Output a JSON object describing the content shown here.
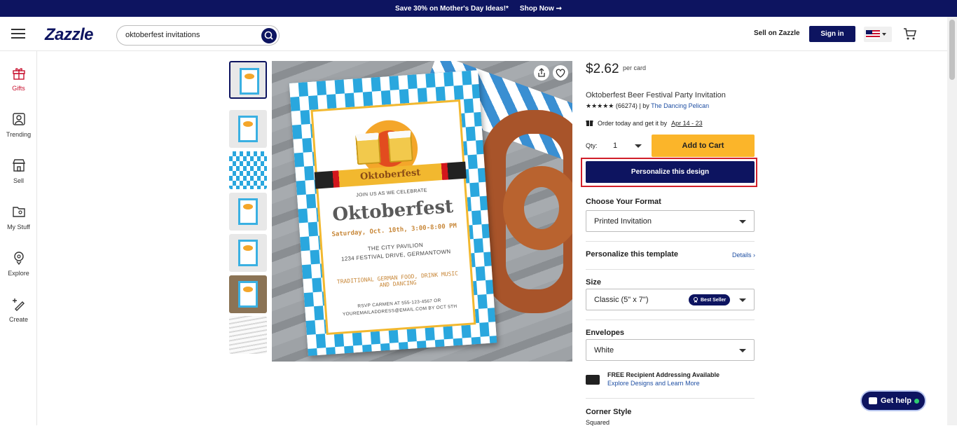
{
  "promo": {
    "text": "Save 30% on Mother's Day Ideas!*",
    "cta": "Shop Now ➞"
  },
  "header": {
    "logo": "Zazzle",
    "search_value": "oktoberfest invitations",
    "sell_label": "Sell on Zazzle",
    "signin_label": "Sign in"
  },
  "rail": {
    "items": [
      {
        "label": "Gifts",
        "icon": "gift-icon"
      },
      {
        "label": "Trending",
        "icon": "trending-icon"
      },
      {
        "label": "Sell",
        "icon": "store-icon"
      },
      {
        "label": "My Stuff",
        "icon": "folder-icon"
      },
      {
        "label": "Explore",
        "icon": "explore-icon"
      },
      {
        "label": "Create",
        "icon": "create-icon"
      }
    ]
  },
  "card": {
    "banner": "Oktoberfest",
    "join": "JOIN US AS WE CELEBRATE",
    "title": "Oktoberfest",
    "date": "Saturday, Oct. 10th, 3:00-8:00 PM",
    "venue1": "THE CITY PAVILION",
    "venue2": "1234 FESTIVAL DRIVE, GERMANTOWN",
    "food": "TRADITIONAL GERMAN FOOD, DRINK MUSIC AND DANCING",
    "rsvp1": "RSVP CARMEN AT 555-123-4567  OR",
    "rsvp2": "YOUREMAILADDRESS@EMAIL.COM BY OCT 5TH"
  },
  "product": {
    "price": "$2.62",
    "per_card": "per card",
    "title": "Oktoberfest Beer Festival Party Invitation",
    "stars": "★★★★★",
    "reviews": "(66274) | by",
    "seller": "The Dancing Pelican",
    "order_text": "Order today and get it by",
    "order_date": "Apr 14 - 23",
    "qty_label": "Qty:",
    "qty_value": "1",
    "add_to_cart": "Add to Cart",
    "personalize": "Personalize this design"
  },
  "options": {
    "format_title": "Choose Your Format",
    "format_value": "Printed Invitation",
    "template_title": "Personalize this template",
    "details": "Details ›",
    "size_title": "Size",
    "size_value": "Classic (5\" x 7\")",
    "best_seller": "Best Seller",
    "envelopes_title": "Envelopes",
    "envelopes_value": "White",
    "addr_title": "FREE Recipient Addressing Available",
    "addr_link": "Explore Designs and Learn More",
    "corner_title": "Corner Style",
    "corner_value": "Squared"
  },
  "help": {
    "label": "Get help"
  },
  "colors": {
    "brand": "#0d1460",
    "cta": "#fbb52a",
    "highlight": "#d11f2a"
  }
}
